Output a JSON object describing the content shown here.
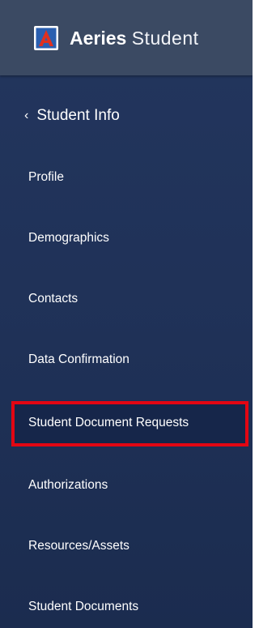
{
  "app": {
    "brand_bold": "Aeries",
    "brand_light": "Student",
    "logo_icon": "aeries-logo-icon"
  },
  "nav": {
    "back_label": "Student Info",
    "back_icon": "chevron-left-icon",
    "items": [
      {
        "label": "Profile"
      },
      {
        "label": "Demographics"
      },
      {
        "label": "Contacts"
      },
      {
        "label": "Data Confirmation"
      },
      {
        "label": "Student Document Requests",
        "highlighted": true
      },
      {
        "label": "Authorizations"
      },
      {
        "label": "Resources/Assets"
      },
      {
        "label": "Student Documents"
      }
    ]
  },
  "colors": {
    "sidebar_background": "#1f3157",
    "header_background": "#3b4a63",
    "highlight_border": "#e30613",
    "logo_blue": "#2a5fb0",
    "logo_red": "#e0301e"
  }
}
